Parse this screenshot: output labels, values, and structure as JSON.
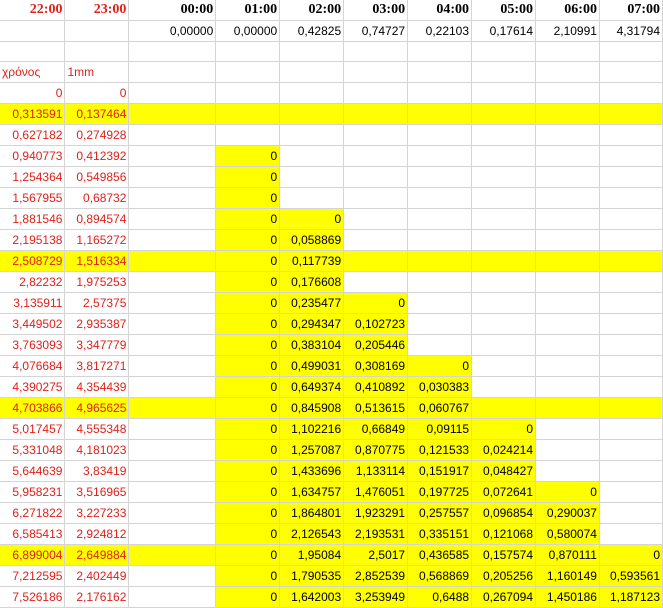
{
  "header_hours": [
    "22:00",
    "23:00",
    "00:00",
    "01:00",
    "02:00",
    "03:00",
    "04:00",
    "05:00",
    "06:00",
    "07:00"
  ],
  "header_values": [
    "",
    "",
    "0,00000",
    "0,00000",
    "0,42825",
    "0,74727",
    "0,22103",
    "0,17614",
    "2,10991",
    "4,31794"
  ],
  "label_row": [
    "χρόνος",
    "1mm"
  ],
  "zero_row": [
    "0",
    "0"
  ],
  "rows": [
    {
      "cells": [
        "0,313591",
        "0,137464",
        "",
        "",
        "",
        "",
        "",
        "",
        "",
        ""
      ],
      "fill": [
        1,
        1,
        1,
        1,
        1,
        1,
        1,
        1,
        1,
        1
      ]
    },
    {
      "cells": [
        "0,627182",
        "0,274928",
        "",
        "",
        "",
        "",
        "",
        "",
        "",
        ""
      ],
      "fill": [
        0,
        0,
        0,
        0,
        0,
        0,
        0,
        0,
        0,
        0
      ]
    },
    {
      "cells": [
        "0,940773",
        "0,412392",
        "",
        "0",
        "",
        "",
        "",
        "",
        "",
        ""
      ],
      "fill": [
        0,
        0,
        0,
        1,
        0,
        0,
        0,
        0,
        0,
        0
      ]
    },
    {
      "cells": [
        "1,254364",
        "0,549856",
        "",
        "0",
        "",
        "",
        "",
        "",
        "",
        ""
      ],
      "fill": [
        0,
        0,
        0,
        1,
        0,
        0,
        0,
        0,
        0,
        0
      ]
    },
    {
      "cells": [
        "1,567955",
        "0,68732",
        "",
        "0",
        "",
        "",
        "",
        "",
        "",
        ""
      ],
      "fill": [
        0,
        0,
        0,
        1,
        0,
        0,
        0,
        0,
        0,
        0
      ]
    },
    {
      "cells": [
        "1,881546",
        "0,894574",
        "",
        "0",
        "0",
        "",
        "",
        "",
        "",
        ""
      ],
      "fill": [
        0,
        0,
        0,
        1,
        1,
        0,
        0,
        0,
        0,
        0
      ]
    },
    {
      "cells": [
        "2,195138",
        "1,165272",
        "",
        "0",
        "0,058869",
        "",
        "",
        "",
        "",
        ""
      ],
      "fill": [
        0,
        0,
        0,
        1,
        1,
        0,
        0,
        0,
        0,
        0
      ]
    },
    {
      "cells": [
        "2,508729",
        "1,516334",
        "",
        "0",
        "0,117739",
        "",
        "",
        "",
        "",
        ""
      ],
      "fill": [
        1,
        1,
        1,
        1,
        1,
        1,
        1,
        1,
        1,
        1
      ]
    },
    {
      "cells": [
        "2,82232",
        "1,975253",
        "",
        "0",
        "0,176608",
        "",
        "",
        "",
        "",
        ""
      ],
      "fill": [
        0,
        0,
        0,
        1,
        1,
        0,
        0,
        0,
        0,
        0
      ]
    },
    {
      "cells": [
        "3,135911",
        "2,57375",
        "",
        "0",
        "0,235477",
        "0",
        "",
        "",
        "",
        ""
      ],
      "fill": [
        0,
        0,
        0,
        1,
        1,
        1,
        0,
        0,
        0,
        0
      ]
    },
    {
      "cells": [
        "3,449502",
        "2,935387",
        "",
        "0",
        "0,294347",
        "0,102723",
        "",
        "",
        "",
        ""
      ],
      "fill": [
        0,
        0,
        0,
        1,
        1,
        1,
        0,
        0,
        0,
        0
      ]
    },
    {
      "cells": [
        "3,763093",
        "3,347779",
        "",
        "0",
        "0,383104",
        "0,205446",
        "",
        "",
        "",
        ""
      ],
      "fill": [
        0,
        0,
        0,
        1,
        1,
        1,
        0,
        0,
        0,
        0
      ]
    },
    {
      "cells": [
        "4,076684",
        "3,817271",
        "",
        "0",
        "0,499031",
        "0,308169",
        "0",
        "",
        "",
        ""
      ],
      "fill": [
        0,
        0,
        0,
        1,
        1,
        1,
        1,
        0,
        0,
        0
      ]
    },
    {
      "cells": [
        "4,390275",
        "4,354439",
        "",
        "0",
        "0,649374",
        "0,410892",
        "0,030383",
        "",
        "",
        ""
      ],
      "fill": [
        0,
        0,
        0,
        1,
        1,
        1,
        1,
        0,
        0,
        0
      ]
    },
    {
      "cells": [
        "4,703866",
        "4,965625",
        "",
        "0",
        "0,845908",
        "0,513615",
        "0,060767",
        "",
        "",
        ""
      ],
      "fill": [
        1,
        1,
        1,
        1,
        1,
        1,
        1,
        1,
        1,
        1
      ]
    },
    {
      "cells": [
        "5,017457",
        "4,555348",
        "",
        "0",
        "1,102216",
        "0,66849",
        "0,09115",
        "0",
        "",
        ""
      ],
      "fill": [
        0,
        0,
        0,
        1,
        1,
        1,
        1,
        1,
        0,
        0
      ]
    },
    {
      "cells": [
        "5,331048",
        "4,181023",
        "",
        "0",
        "1,257087",
        "0,870775",
        "0,121533",
        "0,024214",
        "",
        ""
      ],
      "fill": [
        0,
        0,
        0,
        1,
        1,
        1,
        1,
        1,
        0,
        0
      ]
    },
    {
      "cells": [
        "5,644639",
        "3,83419",
        "",
        "0",
        "1,433696",
        "1,133114",
        "0,151917",
        "0,048427",
        "",
        ""
      ],
      "fill": [
        0,
        0,
        0,
        1,
        1,
        1,
        1,
        1,
        0,
        0
      ]
    },
    {
      "cells": [
        "5,958231",
        "3,516965",
        "",
        "0",
        "1,634757",
        "1,476051",
        "0,197725",
        "0,072641",
        "0",
        ""
      ],
      "fill": [
        0,
        0,
        0,
        1,
        1,
        1,
        1,
        1,
        1,
        0
      ]
    },
    {
      "cells": [
        "6,271822",
        "3,227233",
        "",
        "0",
        "1,864801",
        "1,923291",
        "0,257557",
        "0,096854",
        "0,290037",
        ""
      ],
      "fill": [
        0,
        0,
        0,
        1,
        1,
        1,
        1,
        1,
        1,
        0
      ]
    },
    {
      "cells": [
        "6,585413",
        "2,924812",
        "",
        "0",
        "2,126543",
        "2,193531",
        "0,335151",
        "0,121068",
        "0,580074",
        ""
      ],
      "fill": [
        0,
        0,
        0,
        1,
        1,
        1,
        1,
        1,
        1,
        0
      ]
    },
    {
      "cells": [
        "6,899004",
        "2,649884",
        "",
        "0",
        "1,95084",
        "2,5017",
        "0,436585",
        "0,157574",
        "0,870111",
        "0"
      ],
      "fill": [
        1,
        1,
        1,
        1,
        1,
        1,
        1,
        1,
        1,
        1
      ]
    },
    {
      "cells": [
        "7,212595",
        "2,402449",
        "",
        "0",
        "1,790535",
        "2,852539",
        "0,568869",
        "0,205256",
        "1,160149",
        "0,593561"
      ],
      "fill": [
        0,
        0,
        0,
        1,
        1,
        1,
        1,
        1,
        1,
        1
      ]
    },
    {
      "cells": [
        "7,526186",
        "2,176162",
        "",
        "0",
        "1,642003",
        "3,253949",
        "0,6488",
        "0,267094",
        "1,450186",
        "1,187123"
      ],
      "fill": [
        0,
        0,
        0,
        1,
        1,
        1,
        1,
        1,
        1,
        1
      ]
    }
  ],
  "colors": {
    "highlight": "#ffff00",
    "red_text": "#e0201a",
    "grid": "#d4d4d4"
  }
}
